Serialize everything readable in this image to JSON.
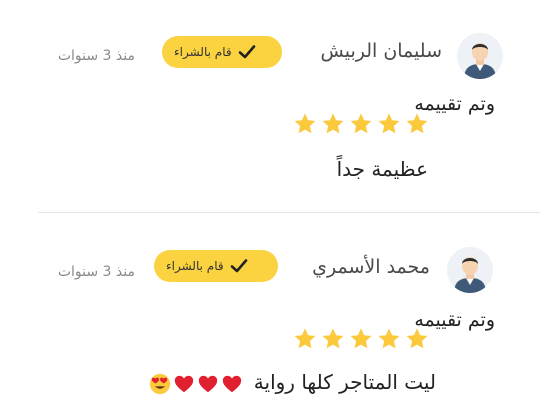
{
  "reviews": [
    {
      "reviewer_name": "سليمان الربيش",
      "badge_label": "قام بالشراء",
      "time_ago": "منذ 3 سنوات",
      "rating_label": "وتم تقييمه",
      "stars": 5,
      "text": "عظيمة جداً",
      "emojis": []
    },
    {
      "reviewer_name": "محمد الأسمري",
      "badge_label": "قام بالشراء",
      "time_ago": "منذ 3 سنوات",
      "rating_label": "وتم تقييمه",
      "stars": 5,
      "text": "ليت المتاجر كلها رواية",
      "emojis": [
        "heart-icon",
        "heart-icon",
        "heart-icon",
        "heart-eyes-icon"
      ]
    }
  ],
  "colors": {
    "badge": "#fbd341",
    "star": "#fbc93b",
    "heart": "#e0202e",
    "avatar_shirt": "#3f5a78",
    "avatar_hair": "#2d2d2d"
  }
}
